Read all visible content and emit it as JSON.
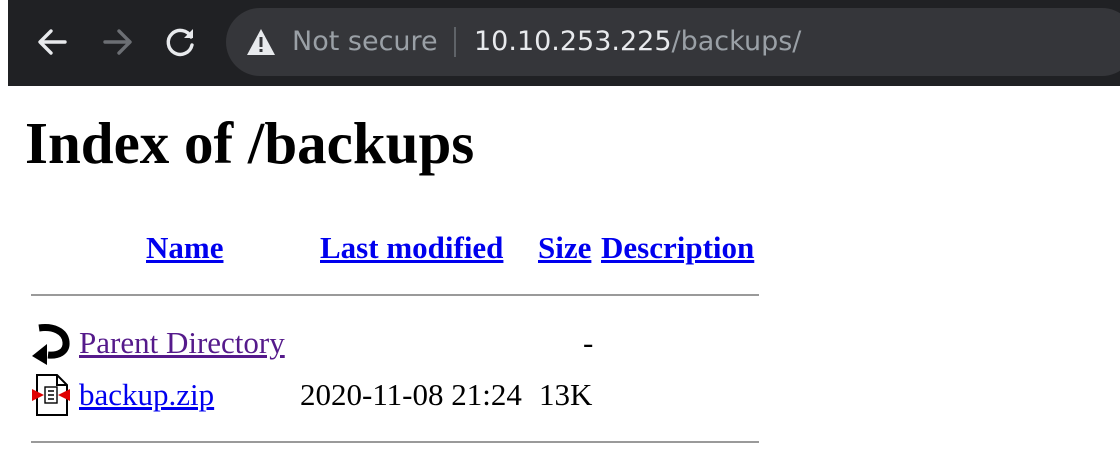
{
  "browser": {
    "security_label": "Not secure",
    "url_host": "10.10.253.225",
    "url_path": "/backups/",
    "icons": {
      "back": "back-arrow-icon",
      "forward": "forward-arrow-icon",
      "reload": "reload-icon",
      "security": "warning-triangle-icon"
    }
  },
  "page": {
    "title": "Index of /backups",
    "columns": {
      "name": "Name",
      "last_modified": "Last modified",
      "size": "Size",
      "description": "Description"
    },
    "rows": [
      {
        "name": "Parent Directory",
        "last_modified": "",
        "size": "-",
        "description": "",
        "icon": "back-folder-icon"
      },
      {
        "name": "backup.zip",
        "last_modified": "2020-11-08 21:24",
        "size": "13K",
        "description": "",
        "icon": "compressed-file-icon"
      }
    ]
  },
  "colors": {
    "link": "#0000ee",
    "visited_link": "#551a8b",
    "chrome_bg": "#202124",
    "omnibox_bg": "#35363a"
  }
}
